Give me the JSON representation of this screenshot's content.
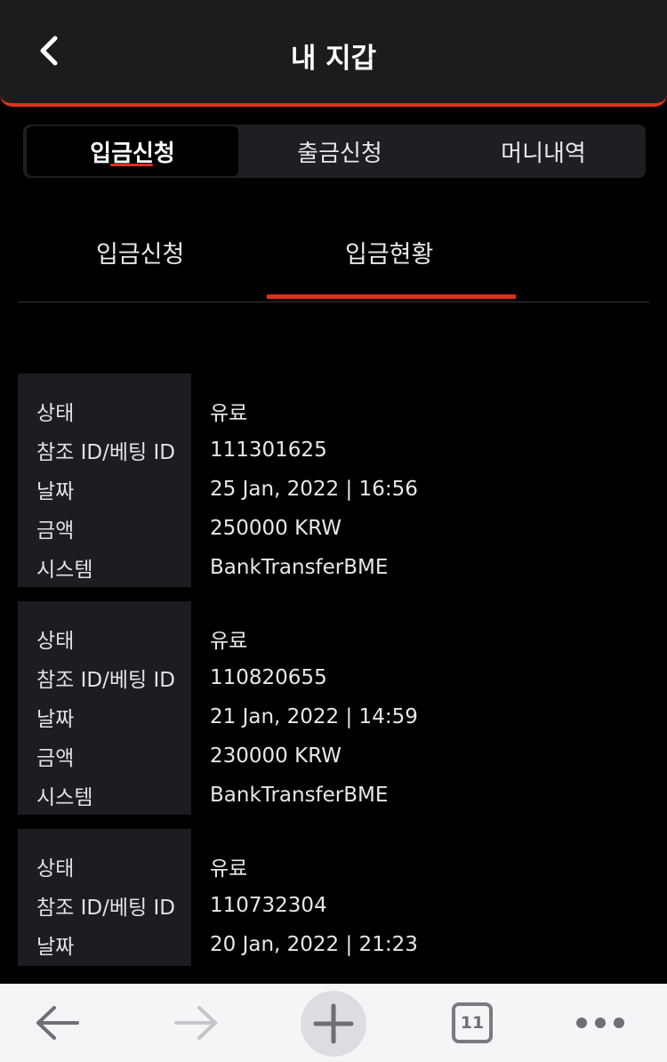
{
  "header": {
    "title": "내 지갑"
  },
  "segments": {
    "deposit_request": "입금신청",
    "withdraw_request": "출금신청",
    "money_history": "머니내역"
  },
  "subtabs": {
    "deposit_request": "입금신청",
    "deposit_status": "입금현황"
  },
  "field_labels": {
    "status": "상태",
    "ref_id": "참조 ID/베팅 ID",
    "date": "날짜",
    "amount": "금액",
    "system": "시스템"
  },
  "records": [
    {
      "status": "유료",
      "ref_id": "111301625",
      "date": "25 Jan, 2022 | 16:56",
      "amount": "250000 KRW",
      "system": "BankTransferBME"
    },
    {
      "status": "유료",
      "ref_id": "110820655",
      "date": "21 Jan, 2022 | 14:59",
      "amount": "230000 KRW",
      "system": "BankTransferBME"
    },
    {
      "status": "유료",
      "ref_id": "110732304",
      "date": "20 Jan, 2022 | 21:23"
    }
  ],
  "bottombar": {
    "tab_count": "11",
    "icons": [
      "back-arrow-icon",
      "forward-arrow-icon",
      "plus-icon",
      "tabs-icon",
      "more-icon"
    ]
  },
  "colors": {
    "accent": "#e0301e",
    "panel": "#1c1d21"
  }
}
